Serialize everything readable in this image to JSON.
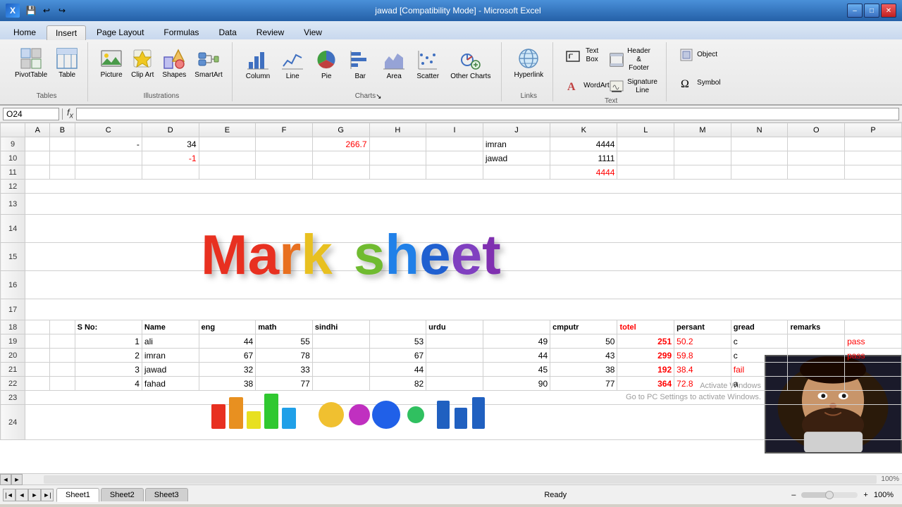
{
  "titleBar": {
    "title": "jawad  [Compatibility Mode] - Microsoft Excel",
    "minBtn": "–",
    "maxBtn": "□",
    "closeBtn": "✕"
  },
  "menuBar": {
    "items": [
      "Home",
      "Insert",
      "Page Layout",
      "Formulas",
      "Data",
      "Review",
      "View"
    ]
  },
  "ribbon": {
    "activeTab": "Insert",
    "tabs": [
      "Home",
      "Insert",
      "Page Layout",
      "Formulas",
      "Data",
      "Review",
      "View"
    ],
    "groups": {
      "tables": {
        "label": "Tables",
        "items": [
          {
            "id": "pivot-table",
            "icon": "⊞",
            "label": "PivotTable"
          },
          {
            "id": "table",
            "icon": "⊟",
            "label": "Table"
          }
        ]
      },
      "illustrations": {
        "label": "Illustrations",
        "items": [
          {
            "id": "picture",
            "icon": "🖼",
            "label": "Picture"
          },
          {
            "id": "clip-art",
            "icon": "✂",
            "label": "Clip Art"
          },
          {
            "id": "shapes",
            "icon": "◻",
            "label": "Shapes"
          },
          {
            "id": "smartart",
            "icon": "⬡",
            "label": "SmartArt"
          }
        ]
      },
      "charts": {
        "label": "Charts",
        "items": [
          {
            "id": "column",
            "icon": "📊",
            "label": "Column"
          },
          {
            "id": "line",
            "icon": "📈",
            "label": "Line"
          },
          {
            "id": "pie",
            "icon": "🥧",
            "label": "Pie"
          },
          {
            "id": "bar",
            "icon": "▬",
            "label": "Bar"
          },
          {
            "id": "area",
            "icon": "△",
            "label": "Area"
          },
          {
            "id": "scatter",
            "icon": "⁘",
            "label": "Scatter"
          },
          {
            "id": "other-charts",
            "icon": "◈",
            "label": "Other Charts"
          }
        ]
      },
      "links": {
        "label": "Links",
        "items": [
          {
            "id": "hyperlink",
            "icon": "🔗",
            "label": "Hyperlink"
          }
        ]
      },
      "text": {
        "label": "Text",
        "items": [
          {
            "id": "text-box",
            "icon": "A",
            "label": "Text Box"
          },
          {
            "id": "header-footer",
            "icon": "⊓",
            "label": "Header & Footer"
          },
          {
            "id": "wordart",
            "icon": "A",
            "label": "WordArt"
          },
          {
            "id": "signature-line",
            "icon": "✏",
            "label": "Signature Line"
          }
        ]
      },
      "object_group": {
        "label": "",
        "items": [
          {
            "id": "object",
            "icon": "◧",
            "label": "Object"
          },
          {
            "id": "symbol",
            "icon": "Ω",
            "label": "Symbol"
          }
        ]
      }
    }
  },
  "formulaBar": {
    "nameBox": "O24",
    "formula": ""
  },
  "cells": {
    "C9": "-",
    "D9": "34",
    "G9": "266.7",
    "J9": "imran",
    "K9": "4444",
    "D10": "-1",
    "J10": "jawad",
    "K10": "1111",
    "K11": "4444"
  },
  "marksheet": {
    "letters": [
      {
        "char": "M",
        "color": "#e8402a"
      },
      {
        "char": "a",
        "color": "#e8402a"
      },
      {
        "char": "r",
        "color": "#e8902a"
      },
      {
        "char": "k",
        "color": "#e8c020"
      },
      {
        "char": " ",
        "color": "transparent"
      },
      {
        "char": "s",
        "color": "#70bb30"
      },
      {
        "char": "h",
        "color": "#2080e8"
      },
      {
        "char": "e",
        "color": "#2080e8"
      },
      {
        "char": "e",
        "color": "#8040c0"
      },
      {
        "char": "t",
        "color": "#8040c0"
      }
    ]
  },
  "tableData": {
    "headers": [
      "S No:",
      "Name",
      "eng",
      "math",
      "sindhi",
      "",
      "urdu",
      "",
      "cmputr",
      "totel",
      "persant",
      "gread",
      "remarks"
    ],
    "rows": [
      {
        "sno": "1",
        "name": "ali",
        "eng": "44",
        "math": "55",
        "sindhi": "53",
        "x": "",
        "urdu": "49",
        "x2": "",
        "cmputr": "50",
        "totel": "251",
        "persant": "50.2",
        "gread": "c",
        "remarks": "pass"
      },
      {
        "sno": "2",
        "name": "imran",
        "eng": "67",
        "math": "78",
        "sindhi": "67",
        "x": "",
        "urdu": "44",
        "x2": "",
        "cmputr": "43",
        "totel": "299",
        "persant": "59.8",
        "gread": "c",
        "remarks": "pass"
      },
      {
        "sno": "3",
        "name": "jawad",
        "eng": "32",
        "math": "33",
        "sindhi": "44",
        "x": "",
        "urdu": "45",
        "x2": "",
        "cmputr": "38",
        "totel": "192",
        "persant": "38.4",
        "gread": "fail",
        "remarks": ""
      },
      {
        "sno": "4",
        "name": "fahad",
        "eng": "38",
        "math": "77",
        "sindhi": "82",
        "x": "",
        "urdu": "90",
        "x2": "",
        "cmputr": "77",
        "totel": "364",
        "persant": "72.8",
        "gread": "a",
        "remarks": ""
      }
    ]
  },
  "sheets": {
    "tabs": [
      "Sheet1",
      "Sheet2",
      "Sheet3"
    ],
    "active": "Sheet1"
  },
  "statusBar": {
    "status": "Ready"
  },
  "activateWindows": {
    "line1": "Activate Windows",
    "line2": "Go to PC Settings to activate Windows."
  }
}
